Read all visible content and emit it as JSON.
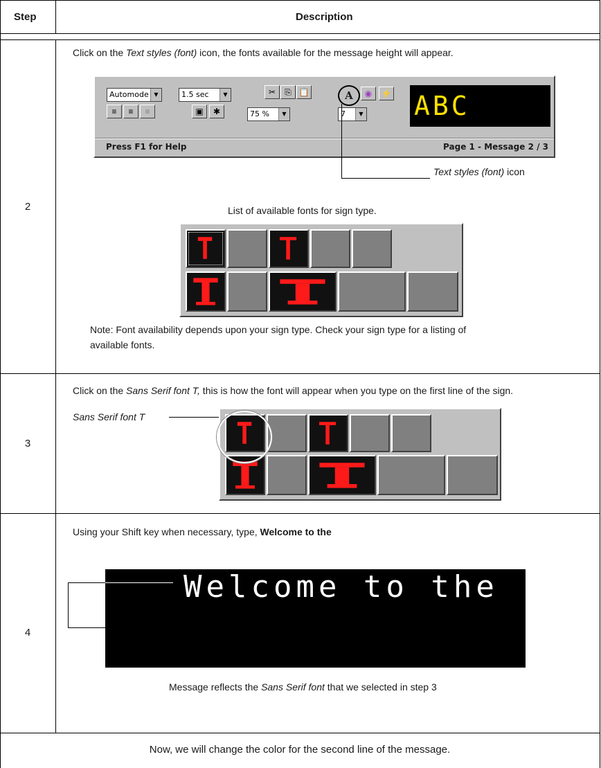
{
  "header": {
    "step_col": "Step",
    "desc_col": "Description"
  },
  "step2": {
    "number": "2",
    "instruction_prefix": "Click on the ",
    "instruction_em": "Text styles (font)",
    "instruction_suffix": " icon, the fonts available for the message height will appear.",
    "toolbar": {
      "mode_select": "Automode",
      "time_select": "1.5 sec",
      "zoom_select": "75 %",
      "height_select": "7",
      "font_icon_glyph": "A",
      "display_text": "ABC",
      "help_text": "Press F1 for Help",
      "page_text": "Page 1  - Message 2 / 3"
    },
    "callout_em": "Text styles (font)",
    "callout_suffix": " icon",
    "list_caption": "List of available fonts for sign type.",
    "note_line1": "Note: Font availability depends upon your sign type. Check your sign type for a listing of",
    "note_line2": "available fonts."
  },
  "step3": {
    "number": "3",
    "instruction_prefix": "Click on the ",
    "instruction_em": "Sans Serif font T,",
    "instruction_suffix": " this is how the font will appear when you type on the first line of the sign.",
    "callout_label": "Sans Serif font T"
  },
  "step4": {
    "number": "4",
    "instruction_prefix": "Using your Shift key when necessary, type, ",
    "instruction_bold": "Welcome to the",
    "sign_text": "Welcome to the",
    "caption_prefix": "Message reflects the ",
    "caption_em": "Sans Serif font",
    "caption_suffix": " that we selected in step 3"
  },
  "footer": {
    "text": "Now, we will change the color for the second line of the message."
  },
  "colors": {
    "led_red": "#ff1a1a",
    "led_yellow": "#ffe000",
    "panel_gray": "#c0c0c0",
    "tile_gray": "#808080"
  }
}
